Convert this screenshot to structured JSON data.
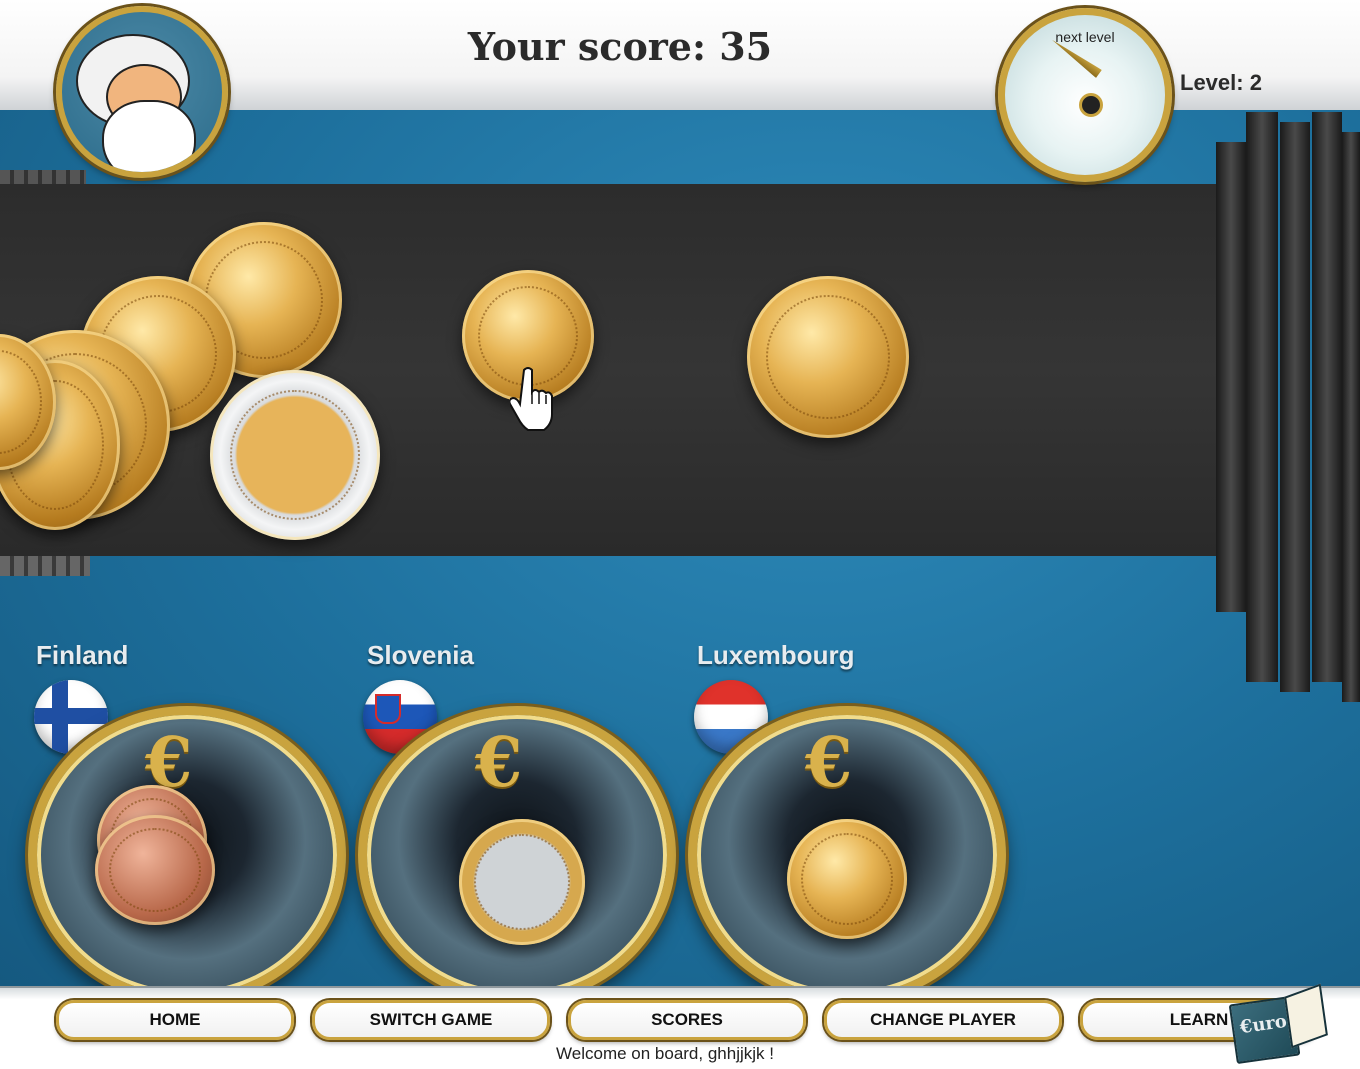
{
  "header": {
    "score_text": "Your score: 35",
    "level_text": "Level: 2",
    "clock_label": "next level"
  },
  "targets": [
    {
      "country": "Finland"
    },
    {
      "country": "Slovenia"
    },
    {
      "country": "Luxembourg"
    }
  ],
  "nav": {
    "home": "HOME",
    "switch_game": "SWITCH GAME",
    "scores": "SCORES",
    "change_player": "CHANGE PLAYER",
    "learn": "LEARN"
  },
  "footer": {
    "welcome": "Welcome on board, ghhjjkjk !",
    "book_label": "€uro"
  },
  "colors": {
    "gold": "#c9a33e",
    "board_blue": "#1d6f9c",
    "belt": "#2f2f2f"
  }
}
